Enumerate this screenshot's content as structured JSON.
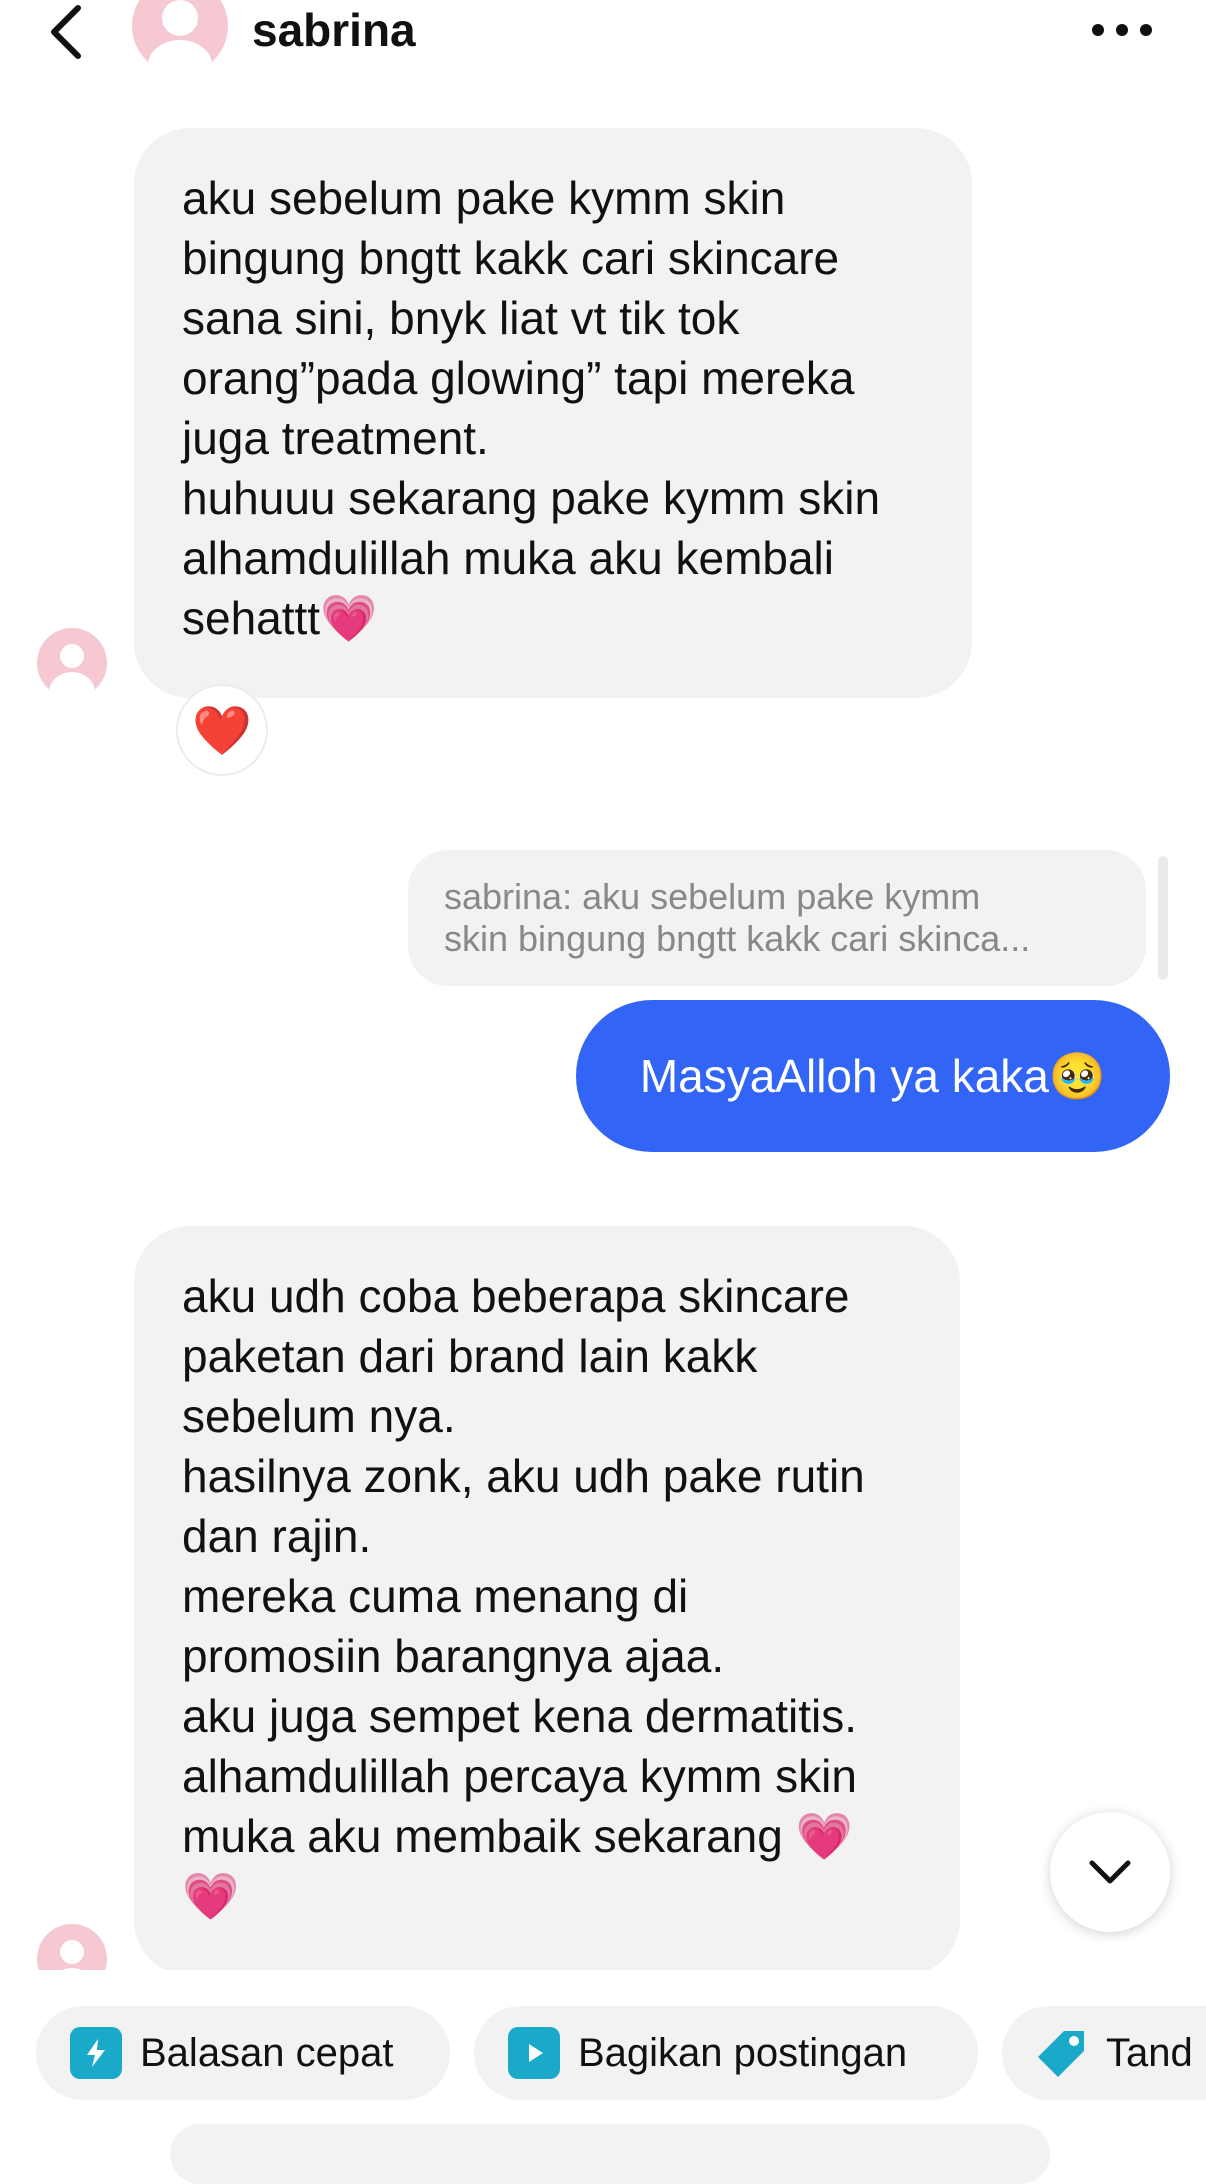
{
  "header": {
    "username": "sabrina"
  },
  "messages": [
    {
      "sender": "sabrina",
      "text": "aku sebelum pake kymm skin\nbingung bngtt kakk cari skincare\nsana sini, bnyk liat vt tik tok\norang”pada glowing” tapi mereka\njuga treatment.\nhuhuuu sekarang pake kymm skin\nalhamdulillah muka aku kembali\nsehattt💗",
      "reaction": "❤️"
    },
    {
      "sender": "me",
      "reply_quote": "sabrina: aku sebelum pake kymm\nskin bingung bngtt kakk cari skinca...",
      "text": "MasyaAlloh ya kaka🥹"
    },
    {
      "sender": "sabrina",
      "text": "aku udh coba beberapa skincare\npaketan dari brand lain kakk\nsebelum nya.\nhasilnya zonk, aku udh pake rutin\ndan rajin.\nmereka cuma menang di\npromosiin barangnya ajaa.\naku juga sempet kena dermatitis.\nalhamdulillah percaya kymm skin\nmuka aku membaik sekarang 💗\n💗"
    }
  ],
  "quick_actions": [
    {
      "label": "Balasan cepat",
      "icon": "bolt-chat-icon"
    },
    {
      "label": "Bagikan postingan",
      "icon": "play-square-icon"
    },
    {
      "label": "Tand",
      "icon": "tag-icon"
    }
  ],
  "colors": {
    "outgoing_bubble": "#3264f5",
    "incoming_bubble": "#f2f2f2",
    "avatar_placeholder": "#f6c9d2",
    "icon_teal": "#1aa9c9"
  }
}
